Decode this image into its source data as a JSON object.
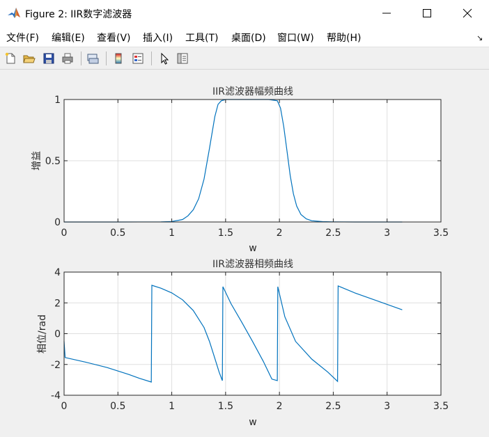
{
  "window": {
    "title": "Figure 2: IIR数字滤波器",
    "icon": "matlab-logo-icon"
  },
  "menu": {
    "items": [
      "文件(F)",
      "编辑(E)",
      "查看(V)",
      "插入(I)",
      "工具(T)",
      "桌面(D)",
      "窗口(W)",
      "帮助(H)"
    ],
    "dock_arrow": "↘"
  },
  "toolbar": {
    "icons": [
      "new-figure-icon",
      "open-file-icon",
      "save-icon",
      "print-icon",
      "link-plot-icon",
      "insert-colorbar-icon",
      "insert-legend-icon",
      "select-arrow-icon",
      "property-inspector-icon"
    ]
  },
  "colors": {
    "line": "#0072bd",
    "grid": "#dfdfdf",
    "axes_bg": "#ffffff",
    "figure_bg": "#f0f0f0"
  },
  "chart_data": [
    {
      "type": "line",
      "title": "IIR滤波器幅频曲线",
      "xlabel": "w",
      "ylabel": "增益",
      "xlim": [
        0,
        3.5
      ],
      "ylim": [
        0,
        1
      ],
      "xticks": [
        "0",
        "0.5",
        "1",
        "1.5",
        "2",
        "2.5",
        "3",
        "3.5"
      ],
      "yticks": [
        "0",
        "0.5",
        "1"
      ],
      "grid": true,
      "series": [
        {
          "x": [
            0,
            0.5,
            0.9,
            1.0,
            1.1,
            1.15,
            1.2,
            1.25,
            1.3,
            1.35,
            1.4,
            1.43,
            1.46,
            1.5,
            1.6,
            1.7,
            1.8,
            1.9,
            1.98,
            2.01,
            2.04,
            2.07,
            2.1,
            2.13,
            2.16,
            2.2,
            2.25,
            2.3,
            2.4,
            2.5,
            2.7,
            3.0,
            3.14
          ],
          "y": [
            0,
            0,
            0.001,
            0.004,
            0.02,
            0.05,
            0.1,
            0.19,
            0.35,
            0.6,
            0.86,
            0.96,
            0.99,
            1.0,
            1.0,
            1.0,
            1.0,
            1.0,
            0.99,
            0.93,
            0.78,
            0.58,
            0.38,
            0.23,
            0.13,
            0.06,
            0.025,
            0.01,
            0.003,
            0.001,
            0,
            0,
            0
          ]
        }
      ]
    },
    {
      "type": "line",
      "title": "IIR滤波器相频曲线",
      "xlabel": "w",
      "ylabel": "相位/rad",
      "xlim": [
        0,
        3.5
      ],
      "ylim": [
        -4,
        4
      ],
      "xticks": [
        "0",
        "0.5",
        "1",
        "1.5",
        "2",
        "2.5",
        "3",
        "3.5"
      ],
      "yticks": [
        "-4",
        "-2",
        "0",
        "2",
        "4"
      ],
      "grid": true,
      "series": [
        {
          "x": [
            0,
            0.01,
            0.2,
            0.4,
            0.6,
            0.7,
            0.81,
            0.815,
            0.9,
            1.0,
            1.1,
            1.2,
            1.3,
            1.35,
            1.4,
            1.44,
            1.47,
            1.475,
            1.55,
            1.65,
            1.75,
            1.85,
            1.93,
            1.98,
            1.985,
            2.05,
            2.15,
            2.3,
            2.45,
            2.54,
            2.545,
            2.7,
            2.9,
            3.14
          ],
          "y": [
            -0.5,
            -1.55,
            -1.85,
            -2.2,
            -2.65,
            -2.9,
            -3.14,
            3.14,
            2.95,
            2.65,
            2.2,
            1.5,
            0.4,
            -0.5,
            -1.6,
            -2.5,
            -3.05,
            3.05,
            1.95,
            0.75,
            -0.5,
            -1.8,
            -2.95,
            -3.05,
            3.05,
            1.1,
            -0.5,
            -1.65,
            -2.5,
            -3.1,
            3.1,
            2.65,
            2.15,
            1.55
          ]
        }
      ]
    }
  ]
}
